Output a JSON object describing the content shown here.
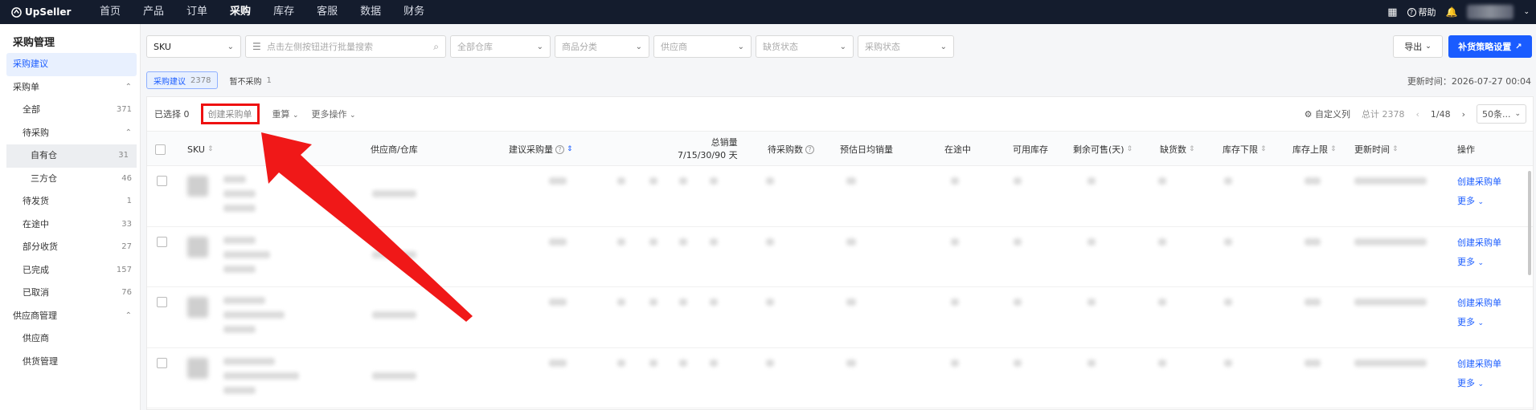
{
  "topnav": {
    "brand": "UpSeller",
    "items": [
      {
        "label": "首页"
      },
      {
        "label": "产品"
      },
      {
        "label": "订单"
      },
      {
        "label": "采购",
        "active": true
      },
      {
        "label": "库存"
      },
      {
        "label": "客服"
      },
      {
        "label": "数据"
      },
      {
        "label": "财务"
      }
    ],
    "help_label": "帮助"
  },
  "sidebar": {
    "title": "采购管理",
    "items": [
      {
        "label": "采购建议",
        "level": 1,
        "active": true
      },
      {
        "label": "采购单",
        "level": 1,
        "chevron": true
      },
      {
        "label": "全部",
        "level": 2,
        "count": "371"
      },
      {
        "label": "待采购",
        "level": 2,
        "chevron": true
      },
      {
        "label": "自有仓",
        "level": 3,
        "count": "31",
        "selected": true
      },
      {
        "label": "三方仓",
        "level": 3,
        "count": "46"
      },
      {
        "label": "待发货",
        "level": 2,
        "count": "1"
      },
      {
        "label": "在途中",
        "level": 2,
        "count": "33"
      },
      {
        "label": "部分收货",
        "level": 2,
        "count": "27"
      },
      {
        "label": "已完成",
        "level": 2,
        "count": "157"
      },
      {
        "label": "已取消",
        "level": 2,
        "count": "76"
      },
      {
        "label": "供应商管理",
        "level": 1,
        "chevron": true
      },
      {
        "label": "供应商",
        "level": 2
      },
      {
        "label": "供货管理",
        "level": 2
      }
    ]
  },
  "filters": {
    "sku_select": "SKU",
    "search_placeholder": "点击左侧按钮进行批量搜索",
    "warehouse": "全部仓库",
    "category": "商品分类",
    "supplier": "供应商",
    "stock_status": "缺货状态",
    "purchase_status": "采购状态"
  },
  "actions": {
    "export": "导出",
    "strategy": "补货策略设置"
  },
  "tabs": [
    {
      "label": "采购建议",
      "count": "2378",
      "active": true
    },
    {
      "label": "暂不采购",
      "count": "1"
    }
  ],
  "updated_text": "更新时间：2026-07-27 00:04",
  "toolbar": {
    "selected": "已选择 0",
    "create": "创建采购单",
    "recalc": "重算",
    "more": "更多操作",
    "custom_cols": "自定义列",
    "total": "总计 2378",
    "page": "1/48",
    "per_page": "50条..."
  },
  "table": {
    "headers": {
      "sku": "SKU",
      "supplier": "供应商/仓库",
      "suggest": "建议采购量",
      "total_sales": "总销量",
      "total_sales_sub": "7/15/30/90 天",
      "pending": "待采购数",
      "daily": "预估日均销量",
      "transit": "在途中",
      "available": "可用库存",
      "remaining": "剩余可售(天)",
      "shortage": "缺货数",
      "lower": "库存下限",
      "upper": "库存上限",
      "updated": "更新时间",
      "ops": "操作"
    },
    "row_actions": {
      "create": "创建采购单",
      "more": "更多"
    }
  }
}
